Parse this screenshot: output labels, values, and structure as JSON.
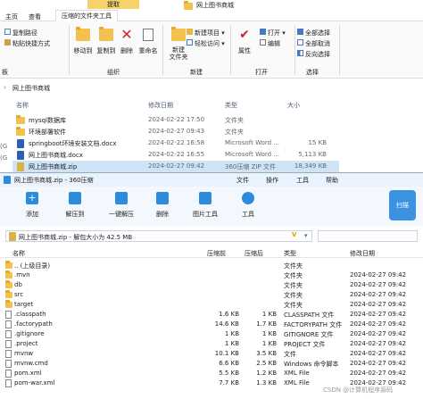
{
  "explorer": {
    "context_tab": "提取",
    "tabs": [
      "主页",
      "查看",
      "压缩的文件夹工具"
    ],
    "window_title": "网上图书商城",
    "ribbon": {
      "copy_path": "复制路径",
      "paste_shortcut": "粘贴快捷方式",
      "move_to": "移动到",
      "copy_to": "复制到",
      "delete": "删除",
      "rename": "重命名",
      "new_folder": "新建\n文件夹",
      "new_item": "新建项目 ▾",
      "easy_access": "轻松访问 ▾",
      "properties": "属性",
      "open": "打开 ▾",
      "edit": "编辑",
      "select_all": "全部选择",
      "select_none": "全部取消",
      "invert": "反向选择",
      "group_organize": "组织",
      "group_new": "新建",
      "group_open": "打开",
      "group_select": "选择",
      "group_left": "板"
    },
    "address_path": "网上图书商城",
    "columns": [
      "名称",
      "修改日期",
      "类型",
      "大小"
    ],
    "files": [
      {
        "name": "mysql数据库",
        "date": "2024-02-22 17:50",
        "type": "文件夹",
        "size": "",
        "icon": "folder-icon"
      },
      {
        "name": "环境部署软件",
        "date": "2024-02-27 09:43",
        "type": "文件夹",
        "size": "",
        "icon": "folder-icon"
      },
      {
        "name": "springboot环境安装文档.docx",
        "date": "2024-02-22 16:58",
        "type": "Microsoft Word ...",
        "size": "15 KB",
        "icon": "word-icon"
      },
      {
        "name": "网上图书商城.docx",
        "date": "2024-02-22 16:55",
        "type": "Microsoft Word ...",
        "size": "5,113 KB",
        "icon": "word-icon"
      },
      {
        "name": "网上图书商城.zip",
        "date": "2024-02-27 09:42",
        "type": "360压缩 ZIP 文件",
        "size": "18,349 KB",
        "icon": "zip-icon"
      }
    ],
    "left_labels": [
      "(G",
      "(G"
    ]
  },
  "zip360": {
    "title": "网上图书商城.zip - 360压缩",
    "menu": [
      "文件",
      "操作",
      "工具",
      "帮助"
    ],
    "toolbar": [
      "添加",
      "解压到",
      "一键解压",
      "删除",
      "图片工具",
      "工具"
    ],
    "scan_label": "扫描",
    "path_text": "网上图书商城.zip - 解包大小为 42.5 MB",
    "columns": [
      "名称",
      "压缩前",
      "压缩后",
      "类型",
      "修改日期"
    ],
    "rows": [
      {
        "name": ".. (上级目录)",
        "before": "",
        "after": "",
        "type": "文件夹",
        "date": "",
        "icon": "folder-icon"
      },
      {
        "name": ".mvn",
        "before": "",
        "after": "",
        "type": "文件夹",
        "date": "2024-02-27 09:42",
        "icon": "folder-icon"
      },
      {
        "name": "db",
        "before": "",
        "after": "",
        "type": "文件夹",
        "date": "2024-02-27 09:42",
        "icon": "folder-icon"
      },
      {
        "name": "src",
        "before": "",
        "after": "",
        "type": "文件夹",
        "date": "2024-02-27 09:42",
        "icon": "folder-icon"
      },
      {
        "name": "target",
        "before": "",
        "after": "",
        "type": "文件夹",
        "date": "2024-02-27 09:42",
        "icon": "folder-icon"
      },
      {
        "name": ".classpath",
        "before": "1.6 KB",
        "after": "1 KB",
        "type": "CLASSPATH 文件",
        "date": "2024-02-27 09:42",
        "icon": "file-icon"
      },
      {
        "name": ".factorypath",
        "before": "14.6 KB",
        "after": "1.7 KB",
        "type": "FACTORYPATH 文件",
        "date": "2024-02-27 09:42",
        "icon": "file-icon"
      },
      {
        "name": ".gitignore",
        "before": "1 KB",
        "after": "1 KB",
        "type": "GITIGNORE 文件",
        "date": "2024-02-27 09:42",
        "icon": "file-icon"
      },
      {
        "name": ".project",
        "before": "1 KB",
        "after": "1 KB",
        "type": "PROJECT 文件",
        "date": "2024-02-27 09:42",
        "icon": "file-icon"
      },
      {
        "name": "mvnw",
        "before": "10.1 KB",
        "after": "3.5 KB",
        "type": "文件",
        "date": "2024-02-27 09:42",
        "icon": "file-icon"
      },
      {
        "name": "mvnw.cmd",
        "before": "6.6 KB",
        "after": "2.5 KB",
        "type": "Windows 命令脚本",
        "date": "2024-02-27 09:42",
        "icon": "file-icon"
      },
      {
        "name": "pom.xml",
        "before": "5.5 KB",
        "after": "1.2 KB",
        "type": "XML File",
        "date": "2024-02-27 09:42",
        "icon": "file-icon"
      },
      {
        "name": "pom-war.xml",
        "before": "7.7 KB",
        "after": "1.3 KB",
        "type": "XML File",
        "date": "2024-02-27 09:42",
        "icon": "file-icon"
      }
    ]
  },
  "watermark": "CSDN @计算机程序源码"
}
